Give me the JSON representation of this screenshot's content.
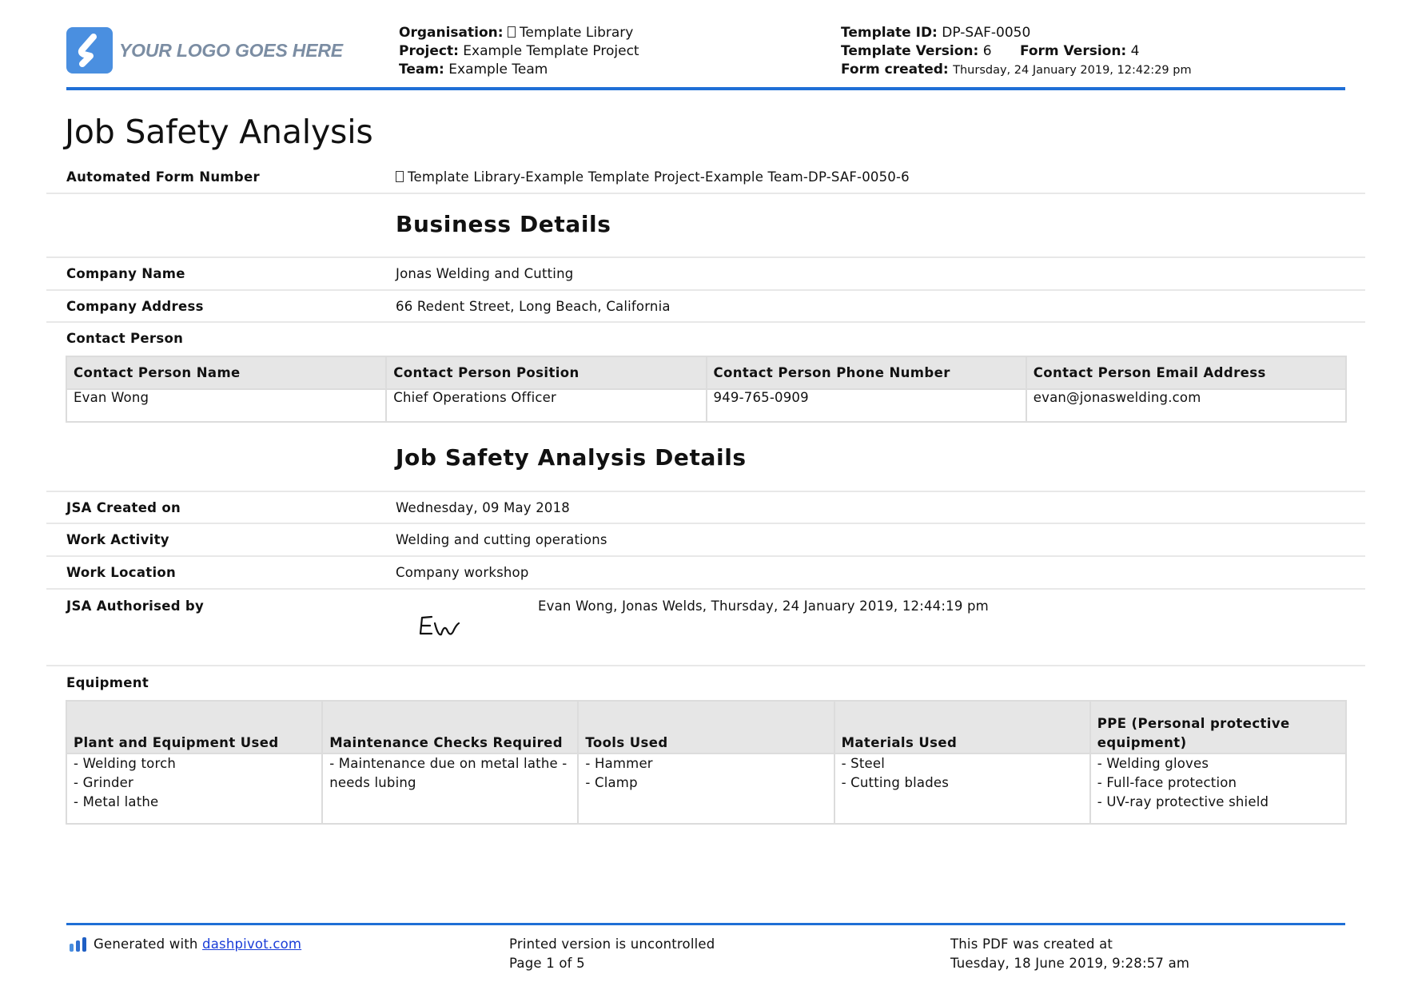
{
  "header": {
    "logo_text": "YOUR LOGO GOES HERE",
    "organisation_label": "Organisation:",
    "organisation_value": "Template Library",
    "project_label": "Project:",
    "project_value": "Example Template Project",
    "team_label": "Team:",
    "team_value": "Example Team",
    "template_id_label": "Template ID:",
    "template_id_value": "DP-SAF-0050",
    "template_version_label": "Template Version:",
    "template_version_value": "6",
    "form_version_label": "Form Version:",
    "form_version_value": "4",
    "form_created_label": "Form created:",
    "form_created_value": "Thursday, 24 January 2019, 12:42:29 pm"
  },
  "document": {
    "title": "Job Safety Analysis",
    "automated_form_number_label": "Automated Form Number",
    "automated_form_number_value": "Template Library-Example Template Project-Example Team-DP-SAF-0050-6"
  },
  "business": {
    "heading": "Business Details",
    "company_name_label": "Company Name",
    "company_name_value": "Jonas Welding and Cutting",
    "company_address_label": "Company Address",
    "company_address_value": "66 Redent Street, Long Beach, California",
    "contact_person_label": "Contact Person",
    "contact_table": {
      "headers": [
        "Contact Person Name",
        "Contact Person Position",
        "Contact Person Phone Number",
        "Contact Person Email Address"
      ],
      "row": [
        "Evan Wong",
        "Chief Operations Officer",
        "949-765-0909",
        "evan@jonaswelding.com"
      ]
    }
  },
  "jsa": {
    "heading": "Job Safety Analysis Details",
    "created_on_label": "JSA Created on",
    "created_on_value": "Wednesday, 09 May 2018",
    "work_activity_label": "Work Activity",
    "work_activity_value": "Welding and cutting operations",
    "work_location_label": "Work Location",
    "work_location_value": "Company workshop",
    "authorised_by_label": "JSA Authorised by",
    "authorised_by_value": "Evan Wong, Jonas Welds, Thursday, 24 January 2019, 12:44:19 pm",
    "signature_text": "EW"
  },
  "equipment": {
    "label": "Equipment",
    "headers": [
      "Plant and Equipment Used",
      "Maintenance Checks Required",
      "Tools Used",
      "Materials Used",
      "PPE (Personal protective equipment)"
    ],
    "cells": [
      [
        "- Welding torch",
        "- Grinder",
        "- Metal lathe"
      ],
      [
        "- Maintenance due on metal lathe -",
        "needs lubing"
      ],
      [
        "- Hammer",
        "- Clamp"
      ],
      [
        "- Steel",
        "- Cutting blades"
      ],
      [
        "- Welding gloves",
        "- Full-face protection",
        "- UV-ray protective shield"
      ]
    ]
  },
  "footer": {
    "generated_with": "Generated with",
    "link_text": "dashpivot.com",
    "printed_notice": "Printed version is uncontrolled",
    "page_info": "Page 1 of 5",
    "pdf_created_label": "This PDF was created at",
    "pdf_created_value": "Tuesday, 18 June 2019, 9:28:57 am"
  },
  "colors": {
    "accent_blue": "#1f6fd6",
    "logo_blue": "#4a8fe0",
    "logo_text_gray": "#7b8da3",
    "table_header_bg": "#e6e6e6",
    "link_blue": "#1a3dd8"
  }
}
